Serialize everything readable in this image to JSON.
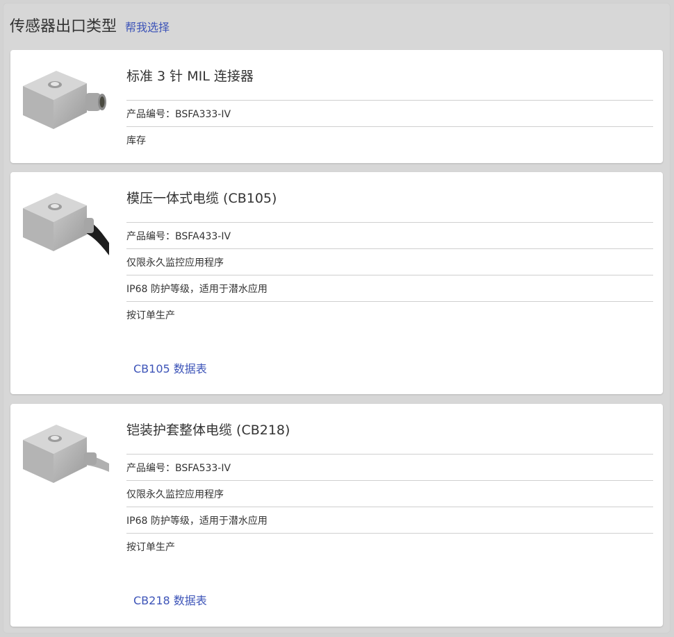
{
  "header": {
    "title": "传感器出口类型",
    "help_link": "帮我选择"
  },
  "cards": [
    {
      "title": "标准 3 针 MIL 连接器",
      "image": "sensor-mil-connector",
      "rows": [
        "产品编号：BSFA333-IV",
        "库存"
      ],
      "datasheet": ""
    },
    {
      "title": "模压一体式电缆 (CB105)",
      "image": "sensor-molded-cable",
      "rows": [
        "产品编号：BSFA433-IV",
        "仅限永久监控应用程序",
        "IP68 防护等级，适用于潜水应用",
        "按订单生产"
      ],
      "datasheet": "CB105 数据表"
    },
    {
      "title": "铠装护套整体电缆 (CB218)",
      "image": "sensor-armored-cable",
      "rows": [
        "产品编号：BSFA533-IV",
        "仅限永久监控应用程序",
        "IP68 防护等级，适用于潜水应用",
        "按订单生产"
      ],
      "datasheet": "CB218 数据表"
    }
  ]
}
